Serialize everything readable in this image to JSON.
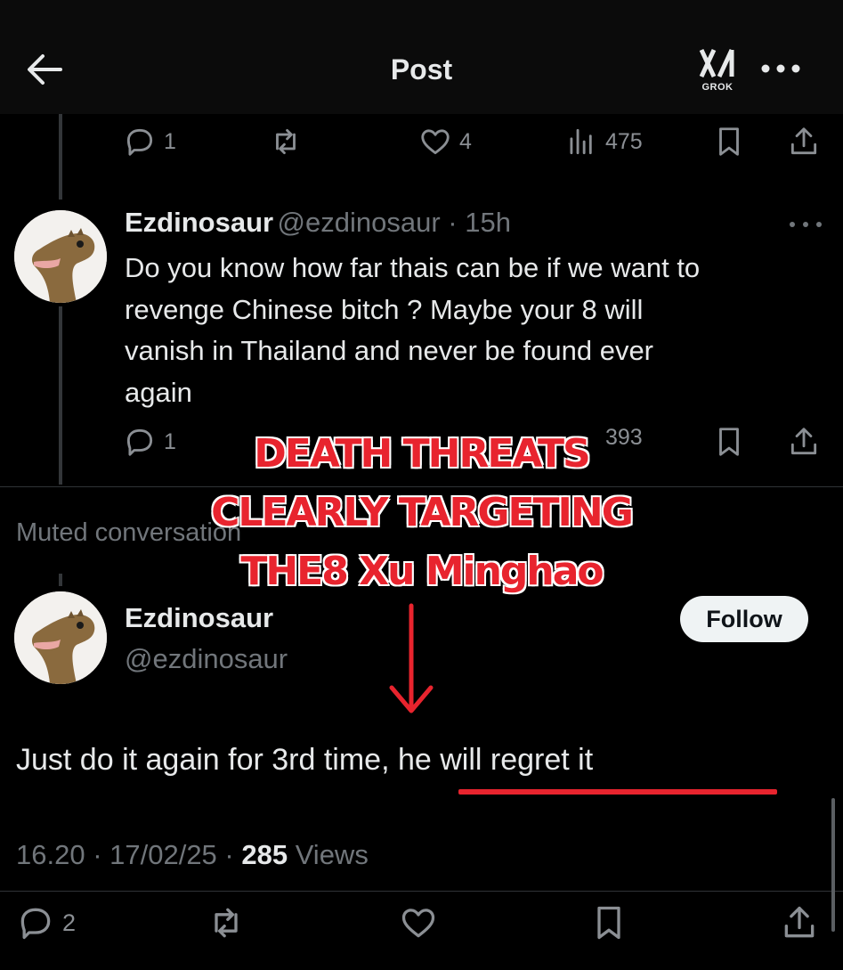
{
  "header": {
    "title": "Post",
    "grok_label": "GROK",
    "icons": [
      "back-arrow-icon",
      "grok-icon",
      "more-icon"
    ]
  },
  "reply1_actions": {
    "replies": "1",
    "likes": "4",
    "views": "475"
  },
  "reply2": {
    "display_name": "Ezdinosaur",
    "handle_time": "@ezdinosaur · 15h",
    "lines": [
      "Do you know how far thais can be if we want to",
      "revenge Chinese bitch ? Maybe your 8 will",
      "vanish in Thailand and never be found ever",
      "again"
    ],
    "replies": "1",
    "views": "393"
  },
  "muted_label": "Muted conversation",
  "main_post": {
    "display_name": "Ezdinosaur",
    "handle": "@ezdinosaur",
    "follow_label": "Follow",
    "text_part1": "Just do it again for 3rd time, ",
    "text_part2": "he will regret it",
    "time": "16.20 · 17/02/25 · ",
    "views_count": "285",
    "views_label": " Views",
    "replies": "2"
  },
  "annotation": {
    "lines": [
      "DEATH THREATS",
      "CLEARLY TARGETING",
      "THE8 Xu Minghao"
    ],
    "color": "#e8242e"
  },
  "colors": {
    "background": "#000000",
    "text": "#e7e9ea",
    "secondary": "#71767b",
    "accent_red": "#e8242e"
  }
}
